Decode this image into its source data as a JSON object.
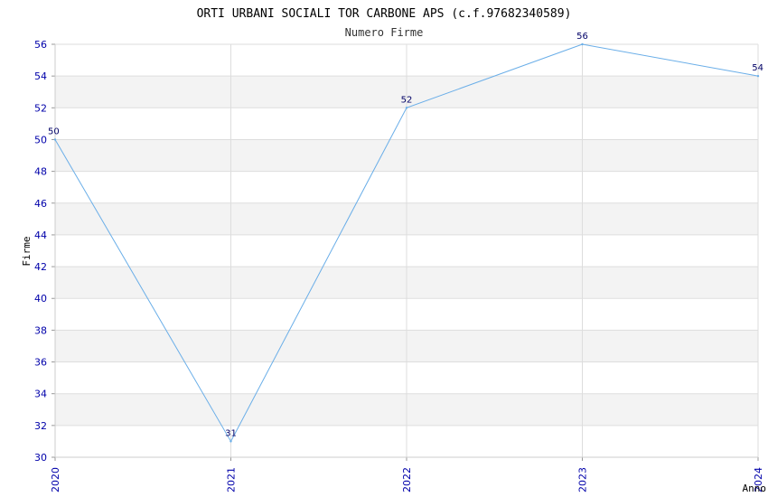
{
  "chart_data": {
    "type": "line",
    "title": "ORTI URBANI SOCIALI TOR CARBONE APS (c.f.97682340589)",
    "subtitle": "Numero Firme",
    "xlabel": "Anno",
    "ylabel": "Firme",
    "categories": [
      "2020",
      "2021",
      "2022",
      "2023",
      "2024"
    ],
    "series": [
      {
        "values": [
          50,
          31,
          52,
          56,
          54
        ]
      }
    ],
    "ylim": [
      30,
      56
    ],
    "ytick_step": 2,
    "grid": true,
    "banded_background": true,
    "colors": {
      "line": "#6aaee8",
      "band": "#f3f3f3",
      "grid": "#dddddd",
      "tick_text": "#0000aa",
      "label_text": "#000066"
    }
  }
}
